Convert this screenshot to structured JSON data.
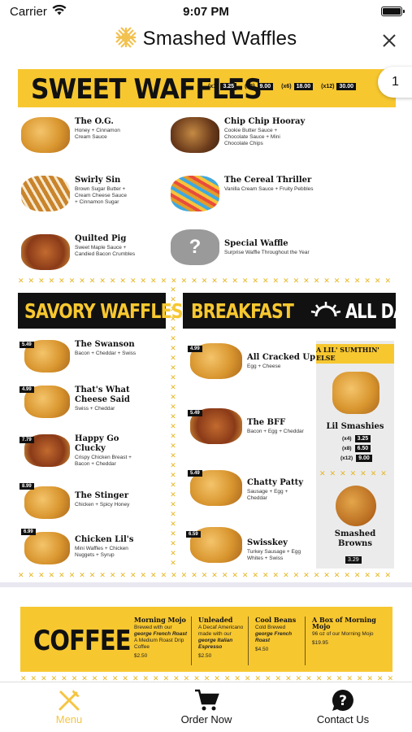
{
  "status": {
    "carrier": "Carrier",
    "time": "9:07 PM"
  },
  "header": {
    "title": "Smashed Waffles"
  },
  "colors": {
    "accent": "#f7c730",
    "tab_active": "#f5c542"
  },
  "sweet": {
    "title": "SWEET WAFFLES",
    "prices": [
      {
        "qty": "(x1)",
        "price": "3.25"
      },
      {
        "qty": "(x3)",
        "price": "9.00"
      },
      {
        "qty": "(x6)",
        "price": "18.00"
      },
      {
        "qty": "(x12)",
        "price": "30.00"
      }
    ],
    "tab_number": "1",
    "items": [
      {
        "name": "The O.G.",
        "desc": "Honey + Cinnamon Cream Sauce"
      },
      {
        "name": "Chip Chip Hooray",
        "desc": "Cookie Butter Sauce + Chocolate Sauce + Mini Chocolate Chips"
      },
      {
        "name": "Swirly Sin",
        "desc": "Brown Sugar Butter + Cream Cheese Sauce + Cinnamon Sugar"
      },
      {
        "name": "The Cereal Thriller",
        "desc": "Vanilla Cream Sauce + Fruity Pebbles"
      },
      {
        "name": "Quilted Pig",
        "desc": "Sweet Maple Sauce + Candied Bacon Crumbles"
      },
      {
        "name": "Special Waffle",
        "desc": "Surprise Waffle Throughout the Year"
      }
    ]
  },
  "savory": {
    "title": "SAVORY WAFFLES",
    "items": [
      {
        "name": "The Swanson",
        "desc": "Bacon + Cheddar + Swiss",
        "price": "5.49"
      },
      {
        "name": "That's What Cheese Said",
        "desc": "Swiss + Cheddar",
        "price": "4.99"
      },
      {
        "name": "Happy Go Clucky",
        "desc": "Crispy Chicken Breast + Bacon + Cheddar",
        "price": "7.79"
      },
      {
        "name": "The Stinger",
        "desc": "Chicken + Spicy Honey",
        "price": "8.99"
      },
      {
        "name": "Chicken Lil's",
        "desc": "Mini Waffles + Chicken Nuggets + Syrup",
        "price": "6.99"
      }
    ]
  },
  "breakfast": {
    "title_a": "BREAKFAST",
    "title_b": "ALL DAY",
    "items": [
      {
        "name": "All Cracked Up",
        "desc": "Egg + Cheese",
        "price": "4.99"
      },
      {
        "name": "The BFF",
        "desc": "Bacon + Egg + Cheddar",
        "price": "5.49"
      },
      {
        "name": "Chatty Patty",
        "desc": "Sausage + Egg + Cheddar",
        "price": "5.49"
      },
      {
        "name": "Swisskey",
        "desc": "Turkey Sausage + Egg Whites + Swiss",
        "price": "6.59"
      }
    ]
  },
  "lil": {
    "title": "A LIL' SUMTHIN' ELSE",
    "smashies": {
      "name": "Lil Smashies",
      "prices": [
        {
          "qty": "(x4)",
          "price": "3.25"
        },
        {
          "qty": "(x8)",
          "price": "6.50"
        },
        {
          "qty": "(x12)",
          "price": "9.00"
        }
      ]
    },
    "browns": {
      "name": "Smashed Browns",
      "price": "3.29"
    }
  },
  "coffee": {
    "title": "COFFEE",
    "items": [
      {
        "name": "Morning Mojo",
        "l1": "Brewed with our",
        "l2": "george French Roast",
        "l3": "A Medium Roast Drip Coffee",
        "price": "$2.50"
      },
      {
        "name": "Unleaded",
        "l1": "A Decaf Americano made with our",
        "l2": "george Italian Espresso",
        "l3": "",
        "price": "$2.50"
      },
      {
        "name": "Cool Beans",
        "l1": "Cold Brewed",
        "l2": "george French Roast",
        "l3": "",
        "price": "$4.50"
      },
      {
        "name": "A Box of Morning Mojo",
        "l1": "96 oz of our Morning Mojo",
        "l2": "",
        "l3": "",
        "price": "$19.95"
      }
    ]
  },
  "tabs": [
    {
      "label": "Menu",
      "icon": "fork-knife-icon",
      "active": true
    },
    {
      "label": "Order Now",
      "icon": "cart-icon",
      "active": false
    },
    {
      "label": "Contact Us",
      "icon": "question-icon",
      "active": false
    }
  ]
}
